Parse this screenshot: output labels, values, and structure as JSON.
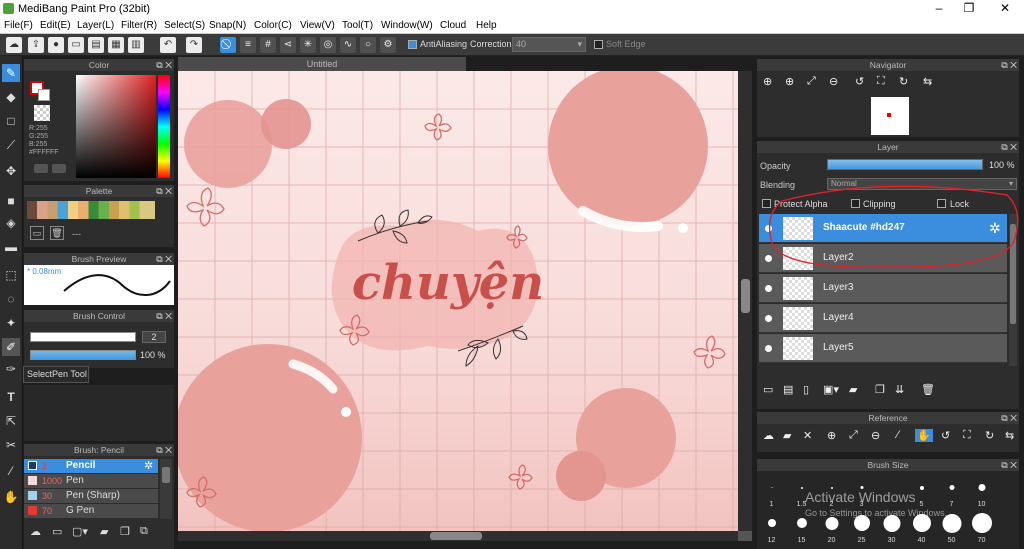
{
  "app": {
    "title": "MediBang Paint Pro (32bit)"
  },
  "menu": [
    "File(F)",
    "Edit(E)",
    "Layer(L)",
    "Filter(R)",
    "Select(S)",
    "Snap(N)",
    "Color(C)",
    "View(V)",
    "Tool(T)",
    "Window(W)",
    "Cloud",
    "Help"
  ],
  "toolbar": {
    "antialiasing": "AntiAliasing",
    "correction_label": "Correction",
    "correction_value": "40",
    "soft_edge": "Soft Edge"
  },
  "tooltip": "SelectPen Tool",
  "color_panel": {
    "title": "Color",
    "r": "R:255",
    "g": "G:255",
    "b": "B:255",
    "hex": "#FFFFFF"
  },
  "palette_panel": {
    "title": "Palette",
    "dash": "---"
  },
  "brush_preview": {
    "title": "Brush Preview",
    "size": "* 0.08mm"
  },
  "brush_control": {
    "title": "Brush Control",
    "size_value": "2",
    "opacity_value": "100 %"
  },
  "brush_list": {
    "title": "Brush: Pencil",
    "items": [
      {
        "size": "2",
        "name": "Pencil",
        "color": "#3b8ede"
      },
      {
        "size": "1000",
        "name": "Pen",
        "color": "#f4d9d8"
      },
      {
        "size": "30",
        "name": "Pen (Sharp)",
        "color": "#9fd3f0"
      },
      {
        "size": "70",
        "name": "G Pen",
        "color": "#e53935"
      }
    ]
  },
  "document": {
    "title": "Untitled",
    "artwork_text": "chuyện"
  },
  "navigator": {
    "title": "Navigator"
  },
  "layer_panel": {
    "title": "Layer",
    "opacity_label": "Opacity",
    "opacity_value": "100 %",
    "blending_label": "Blending",
    "blending_value": "Normal",
    "protect_alpha": "Protect Alpha",
    "clipping": "Clipping",
    "lock": "Lock",
    "layers": [
      "Shaacute #hd247",
      "Layer2",
      "Layer3",
      "Layer4",
      "Layer5"
    ]
  },
  "reference": {
    "title": "Reference"
  },
  "brush_size": {
    "title": "Brush Size",
    "row1": [
      "1",
      "1.5",
      "2",
      "3",
      "5",
      "7",
      "10"
    ],
    "row2": [
      "12",
      "15",
      "20",
      "25",
      "30",
      "40",
      "50",
      "70"
    ]
  },
  "watermark": {
    "line1": "Activate Windows",
    "line2": "Go to Settings to activate Windows."
  },
  "colors": {
    "accent": "#3b8ede",
    "canvas_pink": "#f7d6d4",
    "circle": "#e9a19c",
    "text": "#c9504a",
    "annotation": "#e0202a"
  }
}
